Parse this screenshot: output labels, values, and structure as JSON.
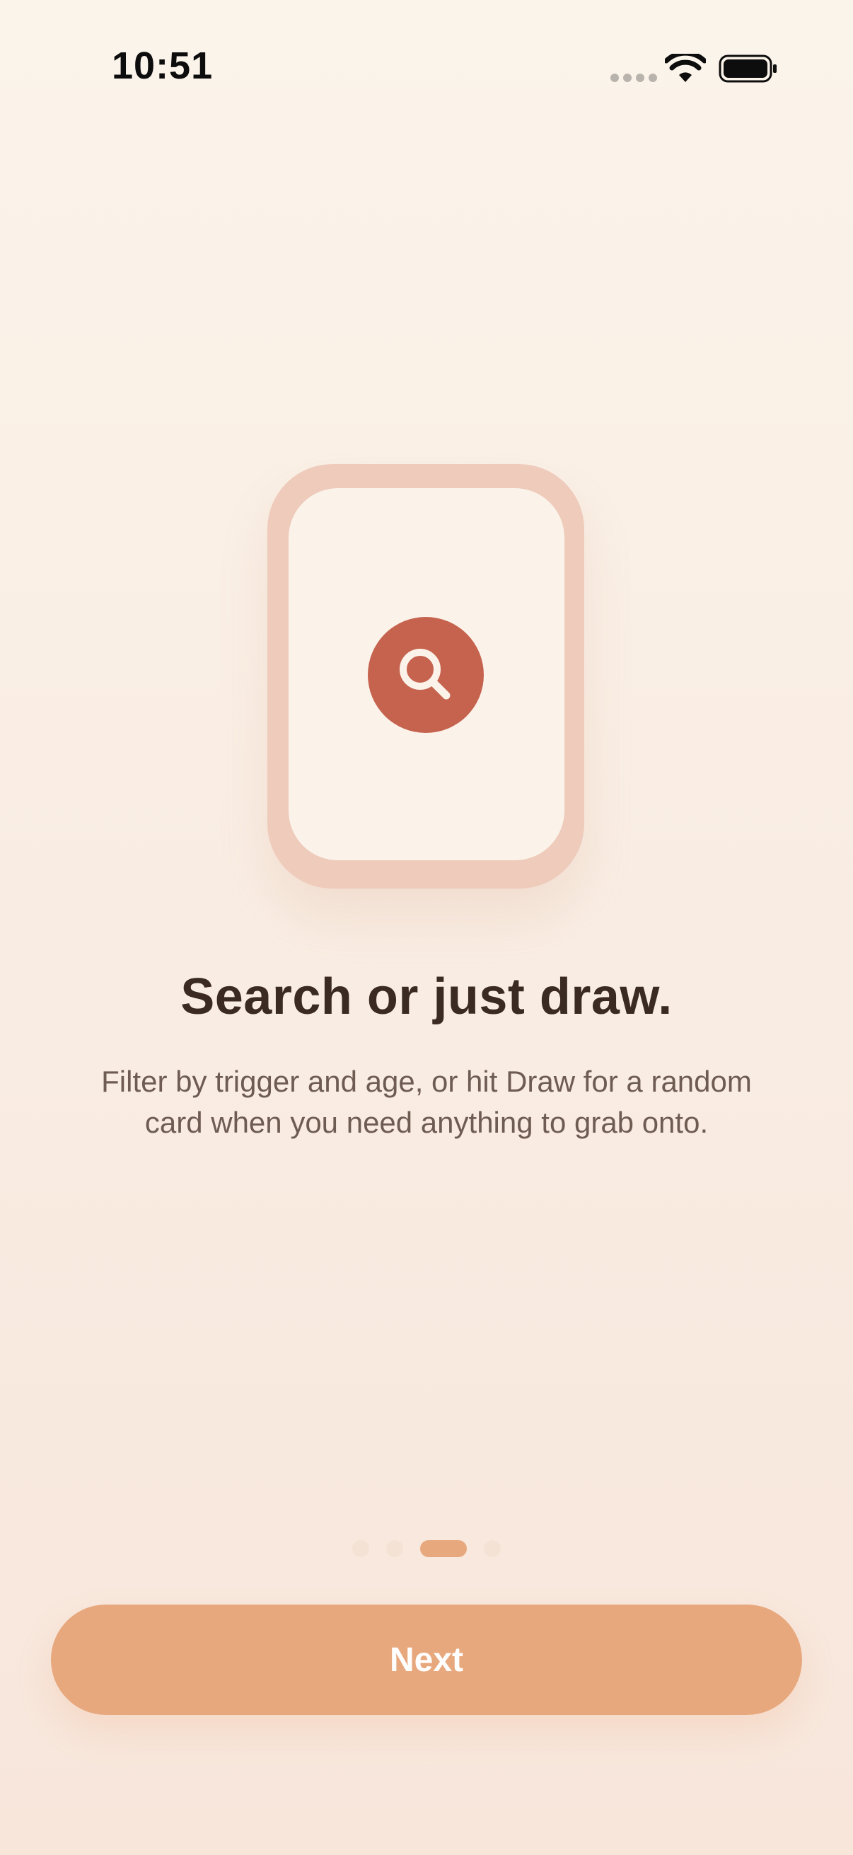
{
  "status_bar": {
    "time": "10:51",
    "icons": [
      "cellular-signal-icon",
      "wifi-icon",
      "battery-icon"
    ]
  },
  "onboarding": {
    "illustration_icon": "search-icon",
    "title": "Search or just draw.",
    "description": "Filter by trigger and age, or hit Draw for a random card when you need anything to grab onto.",
    "page_indicator": {
      "total_pages": 4,
      "current_page": 3
    },
    "next_button_label": "Next"
  },
  "colors": {
    "accent": "#E8A87E",
    "icon_badge": "#C6634F",
    "card_frame": "#EECBBB",
    "card_face": "#FBF3EA",
    "title_text": "#3A2A22",
    "body_text": "#6E5C53"
  }
}
